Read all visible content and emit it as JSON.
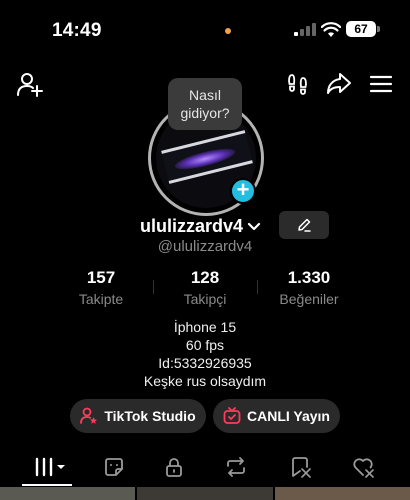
{
  "status": {
    "time": "14:49",
    "battery": "67"
  },
  "tooltip": {
    "text_line1": "Nasıl",
    "text_line2": "gidiyor?"
  },
  "profile": {
    "username": "ululizzardv4",
    "handle": "@ululizzardv4"
  },
  "stats": [
    {
      "value": "157",
      "label": "Takipte"
    },
    {
      "value": "128",
      "label": "Takipçi"
    },
    {
      "value": "1.330",
      "label": "Beğeniler"
    }
  ],
  "bio": [
    "İphone 15",
    "60 fps",
    "Id:5332926935",
    "Keşke rus olsaydım"
  ],
  "buttons": {
    "studio": "TikTok Studio",
    "live": "CANLI Yayın"
  },
  "colors": {
    "accent_blue": "#22bde0",
    "accent_red": "#ff3b5c",
    "background": "#000000"
  }
}
